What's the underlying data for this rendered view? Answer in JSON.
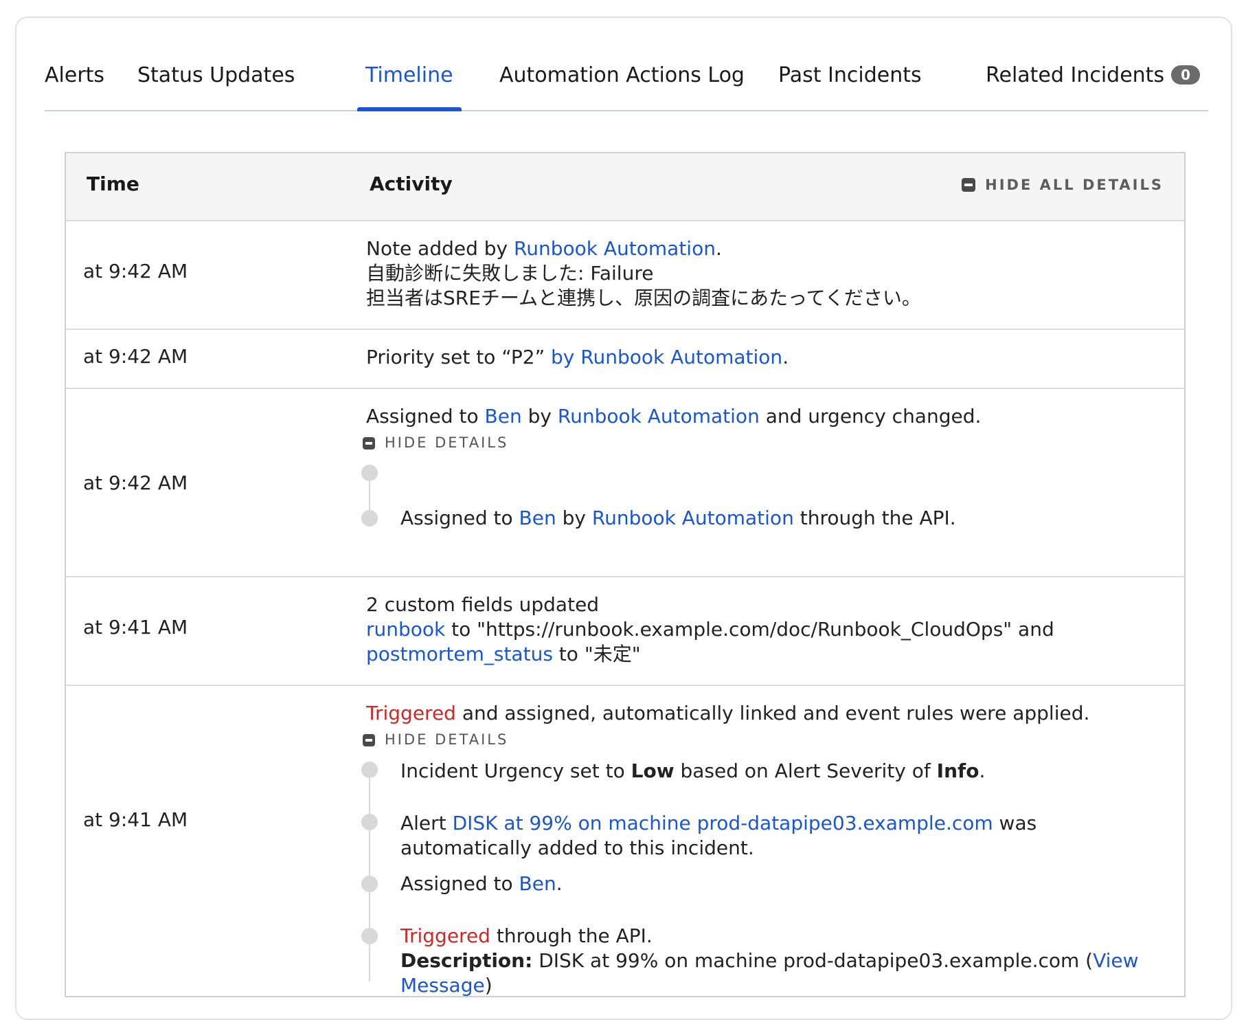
{
  "tabs": [
    {
      "label": "Alerts"
    },
    {
      "label": "Status Updates"
    },
    {
      "label": "Timeline"
    },
    {
      "label": "Automation Actions Log"
    },
    {
      "label": "Past Incidents"
    },
    {
      "label": "Related Incidents",
      "count": "0"
    }
  ],
  "colors": {
    "link": "#1a55d8",
    "triggered": "#d32626",
    "active_tab": "#1a55d8"
  },
  "table": {
    "col_time": "Time",
    "col_activity": "Activity",
    "hide_all": "HIDE ALL DETAILS",
    "hide_details": "HIDE DETAILS"
  },
  "rows": [
    {
      "time": "at 9:42 AM",
      "note_prefix": "Note added by ",
      "note_author": "Runbook Automation",
      "note_line2": "自動診断に失敗しました: Failure",
      "note_line3": "担当者はSREチームと連携し、原因の調査にあたってください。"
    },
    {
      "time": "at 9:42 AM",
      "text": "Priority set to “P2” ",
      "by_link": "by Runbook Automation"
    },
    {
      "time": "at 9:42 AM",
      "prefix": "Assigned to ",
      "assignee": "Ben",
      "by": " by ",
      "agent": "Runbook Automation",
      "suffix": " and urgency changed.",
      "detail_prefix": "Assigned to ",
      "detail_assignee": "Ben",
      "detail_by": " by ",
      "detail_agent": "Runbook Automation",
      "detail_suffix": " through the API."
    },
    {
      "time": "at 9:41 AM",
      "line1": "2 custom fields updated",
      "field1": "runbook",
      "field1_value": " to \"https://runbook.example.com/doc/Runbook_CloudOps\" and",
      "field2": "postmortem_status",
      "field2_value": " to \"未定\""
    },
    {
      "time": "at 9:41 AM",
      "triggered": "Triggered",
      "main_suffix": " and assigned, automatically linked and event rules were applied.",
      "d1_prefix": "Incident Urgency set to ",
      "d1_low": "Low",
      "d1_mid": " based on Alert Severity of ",
      "d1_info": "Info",
      "d1_end": ".",
      "d2_prefix": "Alert ",
      "d2_link": "DISK at 99% on machine prod-datapipe03.example.com",
      "d2_suffix": " was automatically added to this incident.",
      "d3_prefix": "Assigned to ",
      "d3_link": "Ben",
      "d3_end": ".",
      "d4_triggered": "Triggered",
      "d4_suffix": " through the API.",
      "d4_desc_label": "Description:",
      "d4_desc": " DISK at 99% on machine prod-datapipe03.example.com (",
      "d4_view": "View Message",
      "d4_close": ")"
    }
  ]
}
